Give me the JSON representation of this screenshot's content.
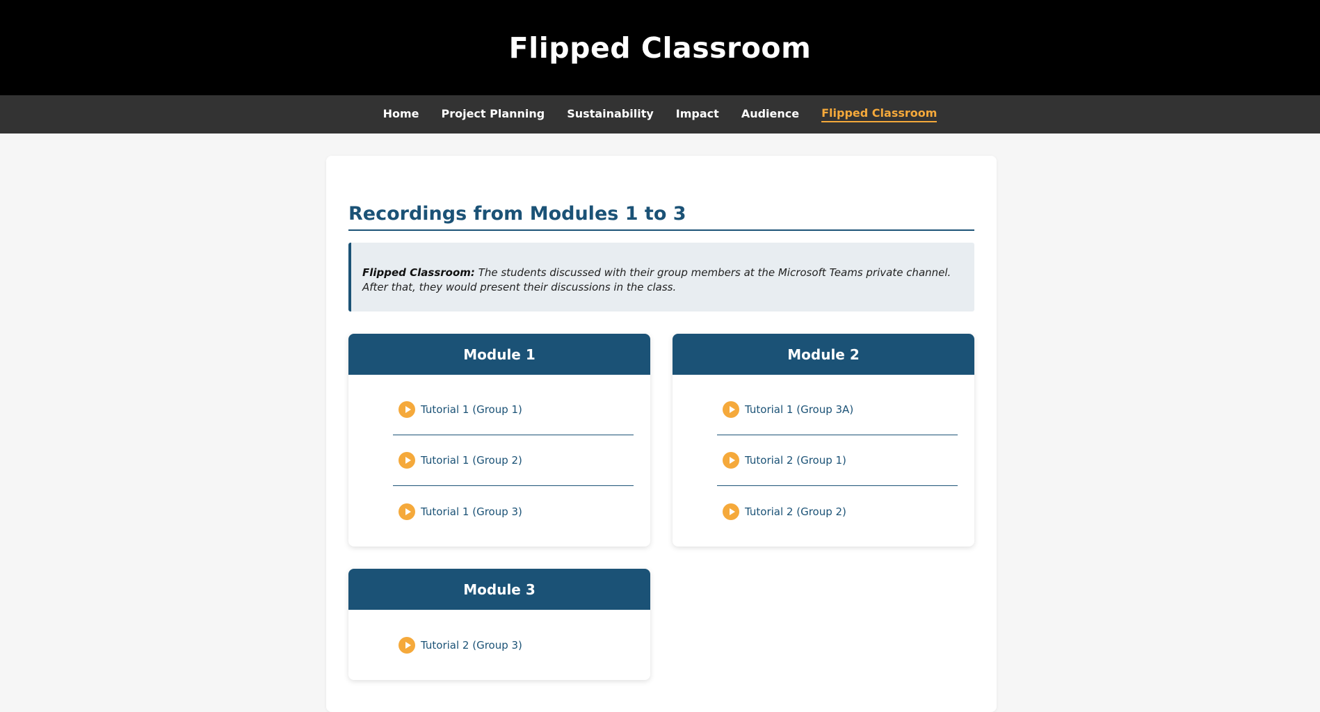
{
  "site": {
    "title": "Flipped Classroom"
  },
  "nav": {
    "items": [
      {
        "label": "Home"
      },
      {
        "label": "Project Planning"
      },
      {
        "label": "Sustainability"
      },
      {
        "label": "Impact"
      },
      {
        "label": "Audience"
      },
      {
        "label": "Flipped Classroom",
        "active": true
      }
    ]
  },
  "main": {
    "title": "Recordings from Modules 1 to 3",
    "note": {
      "label": "Flipped Classroom:",
      "text": "The students discussed with their group members at the Microsoft Teams private channel. After that, they would present their discussions in the class."
    },
    "modules": [
      {
        "title": "Module 1",
        "links": [
          {
            "label": "Tutorial 1 (Group 1)",
            "icon": "play-icon"
          },
          {
            "label": "Tutorial 1 (Group 2)",
            "icon": "play-icon"
          },
          {
            "label": "Tutorial 1 (Group 3)",
            "icon": "play-icon"
          }
        ]
      },
      {
        "title": "Module 2",
        "links": [
          {
            "label": "Tutorial 1 (Group 3A)",
            "icon": "play-icon"
          },
          {
            "label": "Tutorial 2 (Group 1)",
            "icon": "play-icon"
          },
          {
            "label": "Tutorial 2 (Group 2)",
            "icon": "play-icon"
          }
        ]
      },
      {
        "title": "Module 3",
        "links": [
          {
            "label": "Tutorial 2 (Group 3)",
            "icon": "play-icon"
          }
        ]
      }
    ]
  },
  "colors": {
    "header_bg": "#000000",
    "nav_bg": "#333333",
    "accent": "#f5a93b",
    "primary": "#1b5276",
    "page_bg": "#f6f6f6"
  }
}
